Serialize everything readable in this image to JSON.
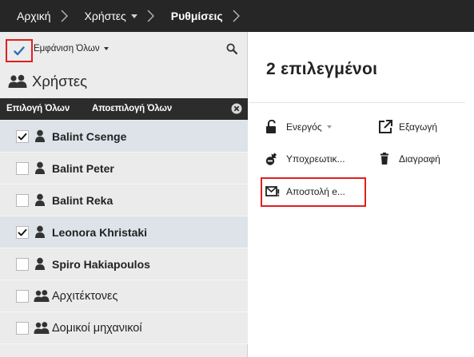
{
  "breadcrumb": {
    "home": "Αρχική",
    "users": "Χρήστες",
    "settings": "Ρυθμίσεις"
  },
  "filter": {
    "show_all_label": "Εμφάνιση Όλων",
    "icons": {
      "check": "check-icon",
      "search": "search-icon"
    }
  },
  "users_header": {
    "title": "Χρήστες",
    "icon": "users-icon"
  },
  "selection_bar": {
    "select_all": "Επιλογή Όλων",
    "deselect_all": "Αποεπιλογή Όλων",
    "clear_icon": "close-circle-icon"
  },
  "list": [
    {
      "label": "Balint Csenge",
      "checked": true,
      "type": "user"
    },
    {
      "label": "Balint Peter",
      "checked": false,
      "type": "user"
    },
    {
      "label": "Balint Reka",
      "checked": false,
      "type": "user"
    },
    {
      "label": "Leonora Khristaki",
      "checked": true,
      "type": "user"
    },
    {
      "label": "Spiro Hakiapoulos",
      "checked": false,
      "type": "user"
    },
    {
      "label": "Αρχιτέκτονες",
      "checked": false,
      "type": "group"
    },
    {
      "label": "Δομικοί μηχανικοί",
      "checked": false,
      "type": "group"
    }
  ],
  "details": {
    "count_title": "2 επιλεγμένοι",
    "actions": {
      "active": "Ενεργός",
      "export": "Εξαγωγή",
      "mandatory": "Υποχρεωτικ...",
      "delete": "Διαγραφή",
      "send": "Αποστολή e..."
    }
  },
  "colors": {
    "topbar": "#262626",
    "selection_bar": "#2c2c2c",
    "selected_row": "#dde3e8",
    "highlight_red": "#e02020",
    "check_blue": "#2f6fb0"
  }
}
